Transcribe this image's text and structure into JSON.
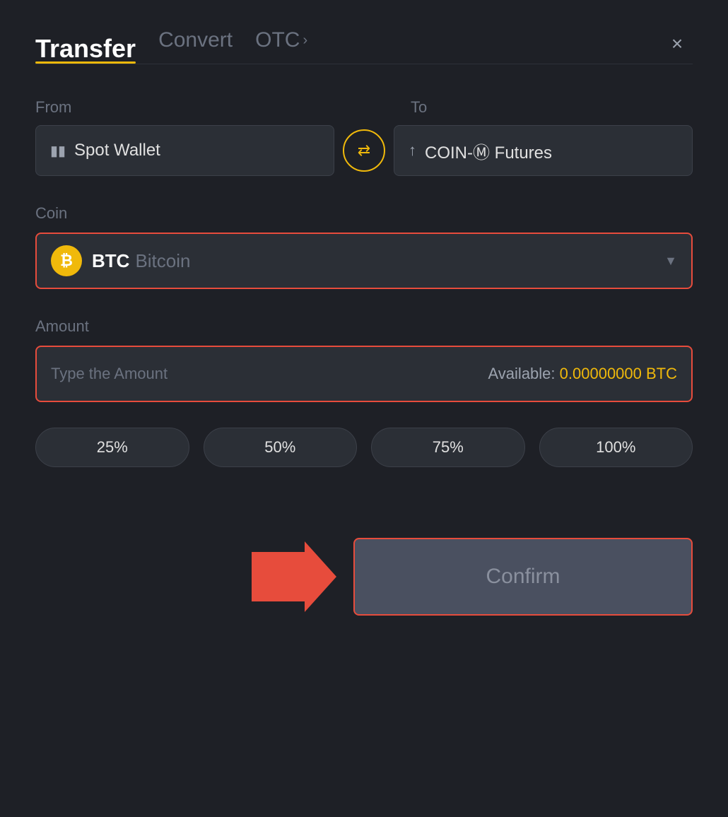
{
  "header": {
    "tab_transfer": "Transfer",
    "tab_convert": "Convert",
    "tab_otc": "OTC",
    "close_label": "×"
  },
  "from_label": "From",
  "to_label": "To",
  "from_wallet": "Spot Wallet",
  "to_wallet": "COIN-Ⓜ Futures",
  "coin_label": "Coin",
  "coin_ticker": "BTC",
  "coin_name": "Bitcoin",
  "amount_label": "Amount",
  "amount_placeholder": "Type the Amount",
  "available_label": "Available:",
  "available_value": "0.00000000 BTC",
  "pct_buttons": [
    "25%",
    "50%",
    "75%",
    "100%"
  ],
  "confirm_label": "Confirm"
}
